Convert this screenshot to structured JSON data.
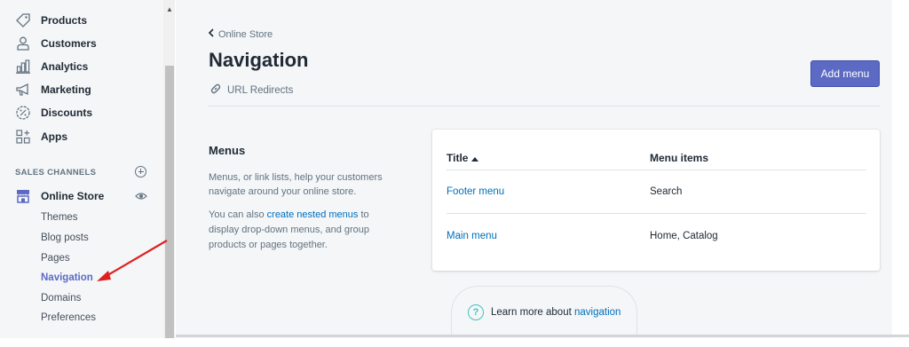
{
  "sidebar": {
    "items": [
      {
        "label": "Products",
        "icon": "tag-icon"
      },
      {
        "label": "Customers",
        "icon": "person-icon"
      },
      {
        "label": "Analytics",
        "icon": "bar-chart-icon"
      },
      {
        "label": "Marketing",
        "icon": "megaphone-icon"
      },
      {
        "label": "Discounts",
        "icon": "discount-icon"
      },
      {
        "label": "Apps",
        "icon": "apps-icon"
      }
    ],
    "sales_channels_heading": "SALES CHANNELS",
    "online_store": {
      "label": "Online Store",
      "icon": "store-icon"
    },
    "sub_items": [
      "Themes",
      "Blog posts",
      "Pages",
      "Navigation",
      "Domains",
      "Preferences"
    ],
    "active_sub_item": "Navigation"
  },
  "header": {
    "breadcrumb": "Online Store",
    "title": "Navigation",
    "url_redirects": "URL Redirects",
    "add_menu_label": "Add menu"
  },
  "menus_section": {
    "heading": "Menus",
    "description": "Menus, or link lists, help your customers navigate around your online store.",
    "nested_prefix": "You can also ",
    "nested_link": "create nested menus",
    "nested_suffix": " to display drop-down menus, and group products or pages together."
  },
  "table": {
    "columns": [
      "Title",
      "Menu items"
    ],
    "rows": [
      {
        "title": "Footer menu",
        "items": "Search"
      },
      {
        "title": "Main menu",
        "items": "Home, Catalog"
      }
    ]
  },
  "learn_more": {
    "prefix": "Learn more about ",
    "link": "navigation"
  },
  "colors": {
    "accent": "#5c6ac4",
    "link": "#006fbb",
    "annotation_arrow": "#e02020"
  }
}
